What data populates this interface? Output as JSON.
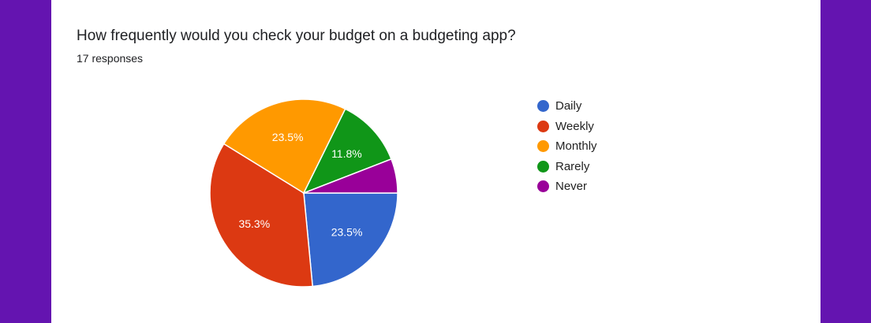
{
  "question": {
    "title": "How frequently would you check your budget on a budgeting app?",
    "responses": "17 responses"
  },
  "chart_data": {
    "type": "pie",
    "title": "How frequently would you check your budget on a budgeting app?",
    "categories": [
      "Daily",
      "Weekly",
      "Monthly",
      "Rarely",
      "Never"
    ],
    "values": [
      23.5,
      35.3,
      23.5,
      11.8,
      5.9
    ],
    "data_labels": [
      "23.5%",
      "35.3%",
      "23.5%",
      "11.8%",
      ""
    ],
    "colors": [
      "#3366cc",
      "#dc3912",
      "#ff9900",
      "#109618",
      "#990099"
    ],
    "legend_position": "right"
  }
}
